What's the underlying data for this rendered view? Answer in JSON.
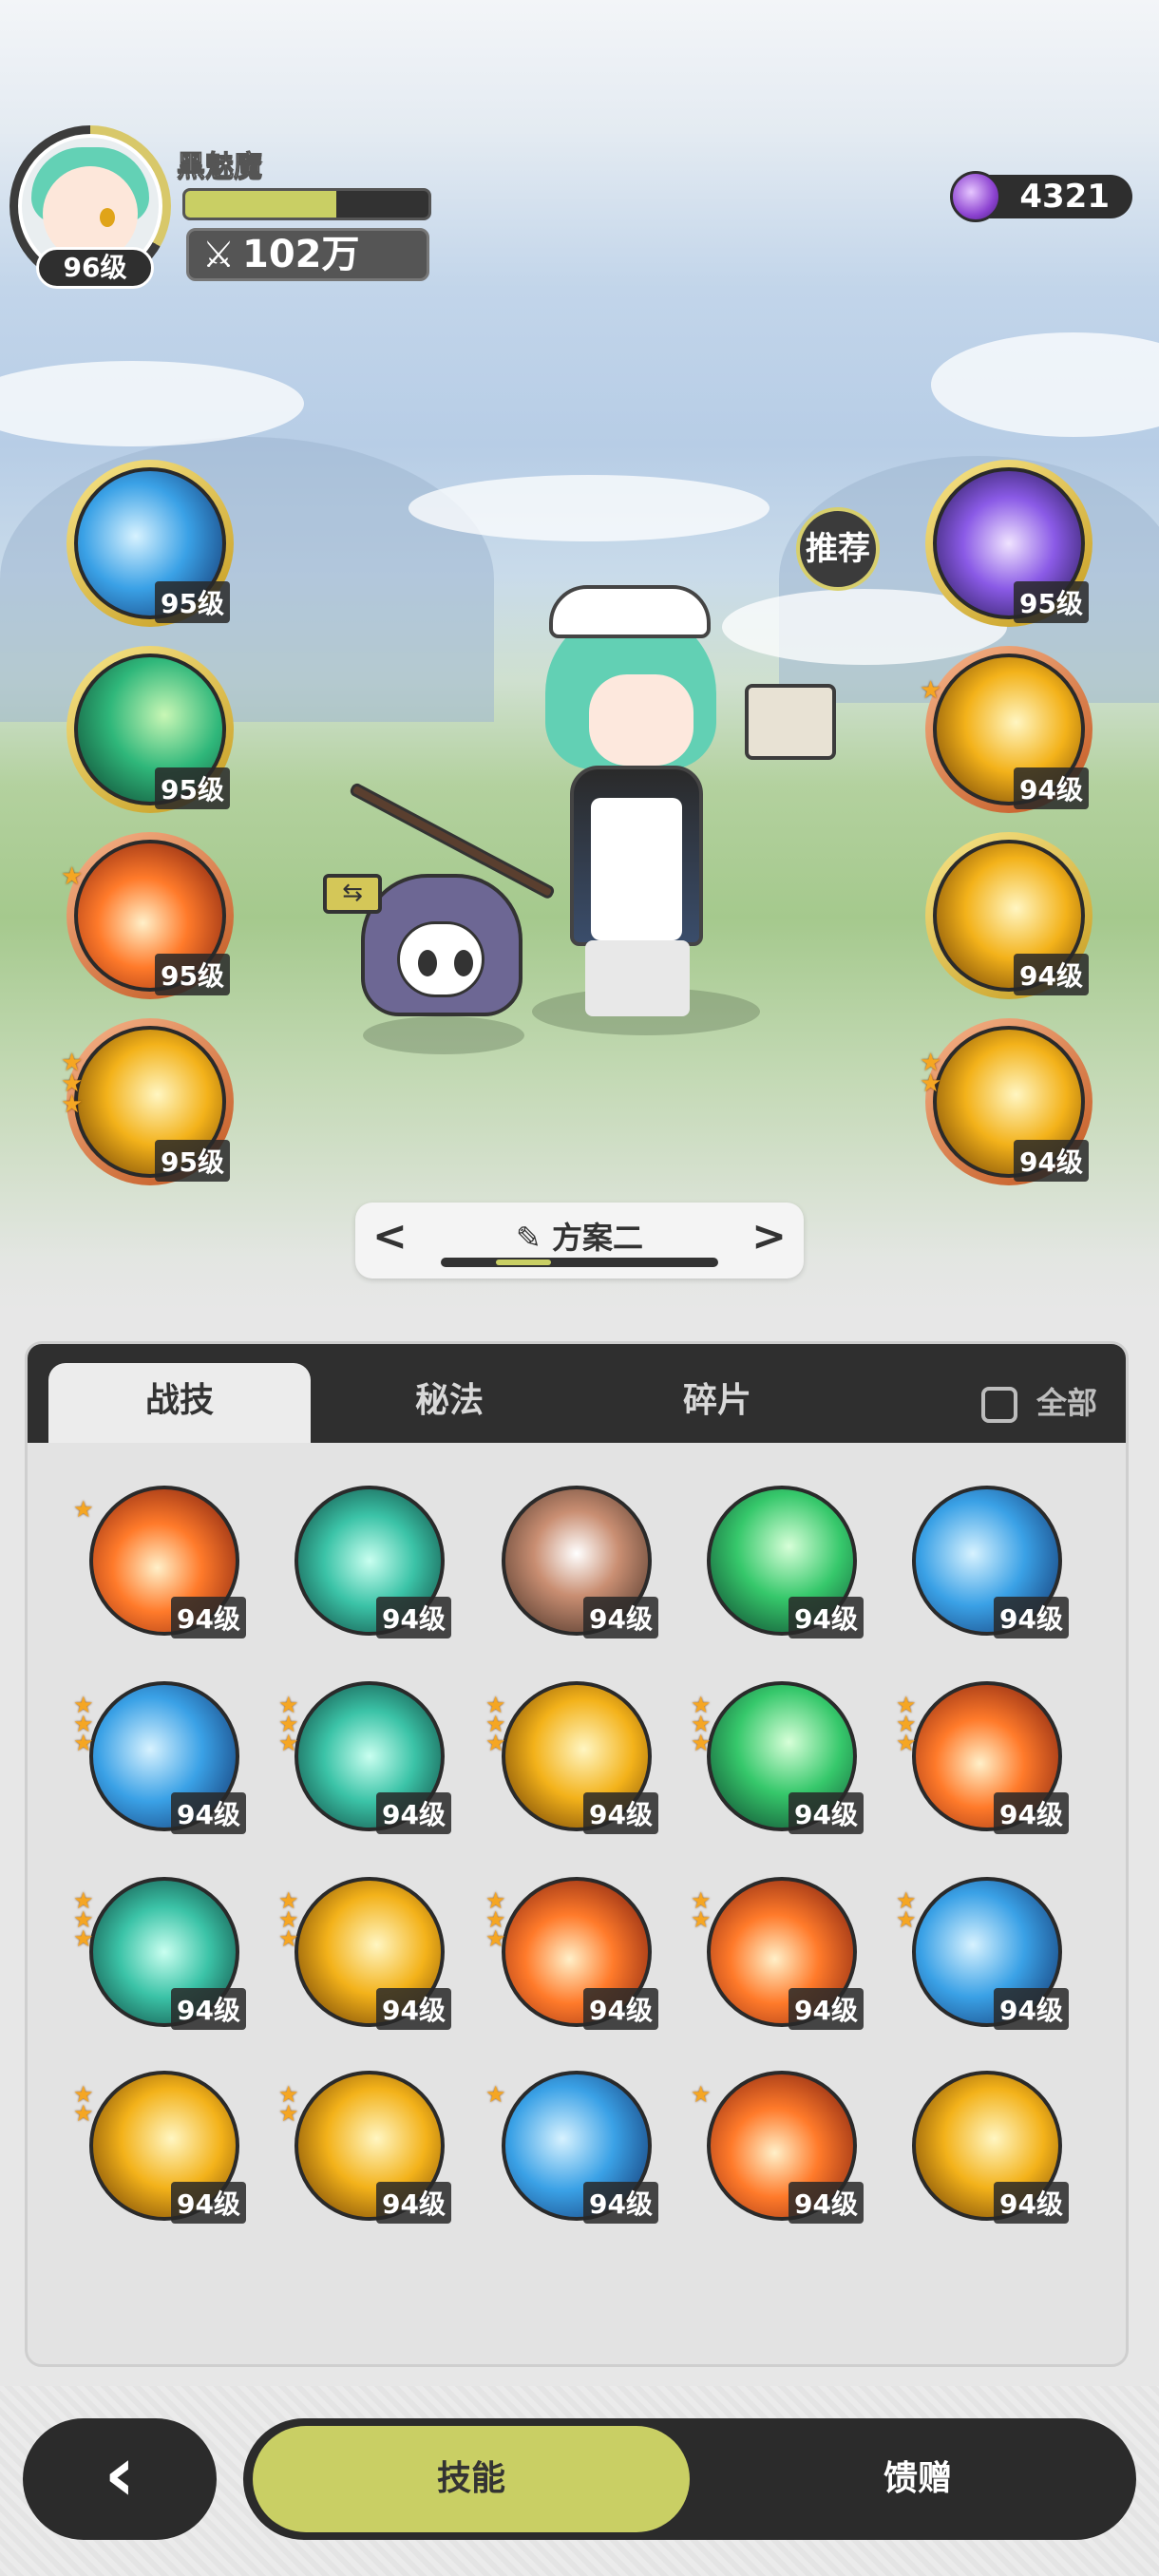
{
  "player": {
    "name": "黑魅魔",
    "level": "96级",
    "power": "102万",
    "hp_ratio": 0.62
  },
  "currency": {
    "icon": "gem-icon",
    "amount": "4321"
  },
  "recommend_label": "推荐",
  "left_skills": [
    {
      "level": "95级",
      "stars": 0,
      "frame": "gold",
      "theme": "blue"
    },
    {
      "level": "95级",
      "stars": 0,
      "frame": "gold",
      "theme": "green"
    },
    {
      "level": "95级",
      "stars": 1,
      "frame": "orange",
      "theme": "red"
    },
    {
      "level": "95级",
      "stars": 3,
      "frame": "orange",
      "theme": "gold"
    }
  ],
  "right_skills": [
    {
      "level": "95级",
      "stars": 0,
      "frame": "gold",
      "theme": "purple"
    },
    {
      "level": "94级",
      "stars": 1,
      "frame": "orange",
      "theme": "gold"
    },
    {
      "level": "94级",
      "stars": 0,
      "frame": "gold",
      "theme": "gold"
    },
    {
      "level": "94级",
      "stars": 2,
      "frame": "orange",
      "theme": "gold"
    }
  ],
  "plan": {
    "title": "方案二",
    "prev": "<",
    "next": ">"
  },
  "tabs": [
    {
      "label": "战技",
      "active": true
    },
    {
      "label": "秘法",
      "active": false
    },
    {
      "label": "碎片",
      "active": false
    }
  ],
  "filter": {
    "label": "全部",
    "checked": false
  },
  "skill_grid": [
    {
      "level": "94级",
      "stars": 1,
      "frame": "gold",
      "theme": "red"
    },
    {
      "level": "94级",
      "stars": 0,
      "frame": "gold",
      "theme": "teal"
    },
    {
      "level": "94级",
      "stars": 0,
      "frame": "gold",
      "theme": "tan"
    },
    {
      "level": "94级",
      "stars": 0,
      "frame": "gold",
      "theme": "mint"
    },
    {
      "level": "94级",
      "stars": 0,
      "frame": "gold",
      "theme": "blue"
    },
    {
      "level": "94级",
      "stars": 3,
      "frame": "orange",
      "theme": "blue"
    },
    {
      "level": "94级",
      "stars": 3,
      "frame": "orange",
      "theme": "teal"
    },
    {
      "level": "94级",
      "stars": 3,
      "frame": "orange",
      "theme": "gold"
    },
    {
      "level": "94级",
      "stars": 3,
      "frame": "orange",
      "theme": "mint"
    },
    {
      "level": "94级",
      "stars": 3,
      "frame": "orange",
      "theme": "red"
    },
    {
      "level": "94级",
      "stars": 3,
      "frame": "orange",
      "theme": "teal"
    },
    {
      "level": "94级",
      "stars": 3,
      "frame": "orange",
      "theme": "gold"
    },
    {
      "level": "94级",
      "stars": 3,
      "frame": "orange",
      "theme": "red"
    },
    {
      "level": "94级",
      "stars": 2,
      "frame": "orange",
      "theme": "red"
    },
    {
      "level": "94级",
      "stars": 2,
      "frame": "orange",
      "theme": "blue"
    },
    {
      "level": "94级",
      "stars": 2,
      "frame": "orange",
      "theme": "gold"
    },
    {
      "level": "94级",
      "stars": 2,
      "frame": "orange",
      "theme": "gold"
    },
    {
      "level": "94级",
      "stars": 1,
      "frame": "orange",
      "theme": "blue"
    },
    {
      "level": "94级",
      "stars": 1,
      "frame": "orange",
      "theme": "red"
    },
    {
      "level": "94级",
      "stars": 0,
      "frame": "orange",
      "theme": "gold"
    }
  ],
  "bottom_nav": {
    "back": "‹",
    "skills": "技能",
    "gift": "馈赠"
  },
  "colors": {
    "accent": "#c9cf64",
    "dark": "#2b2b2b",
    "star": "#f5a623"
  }
}
